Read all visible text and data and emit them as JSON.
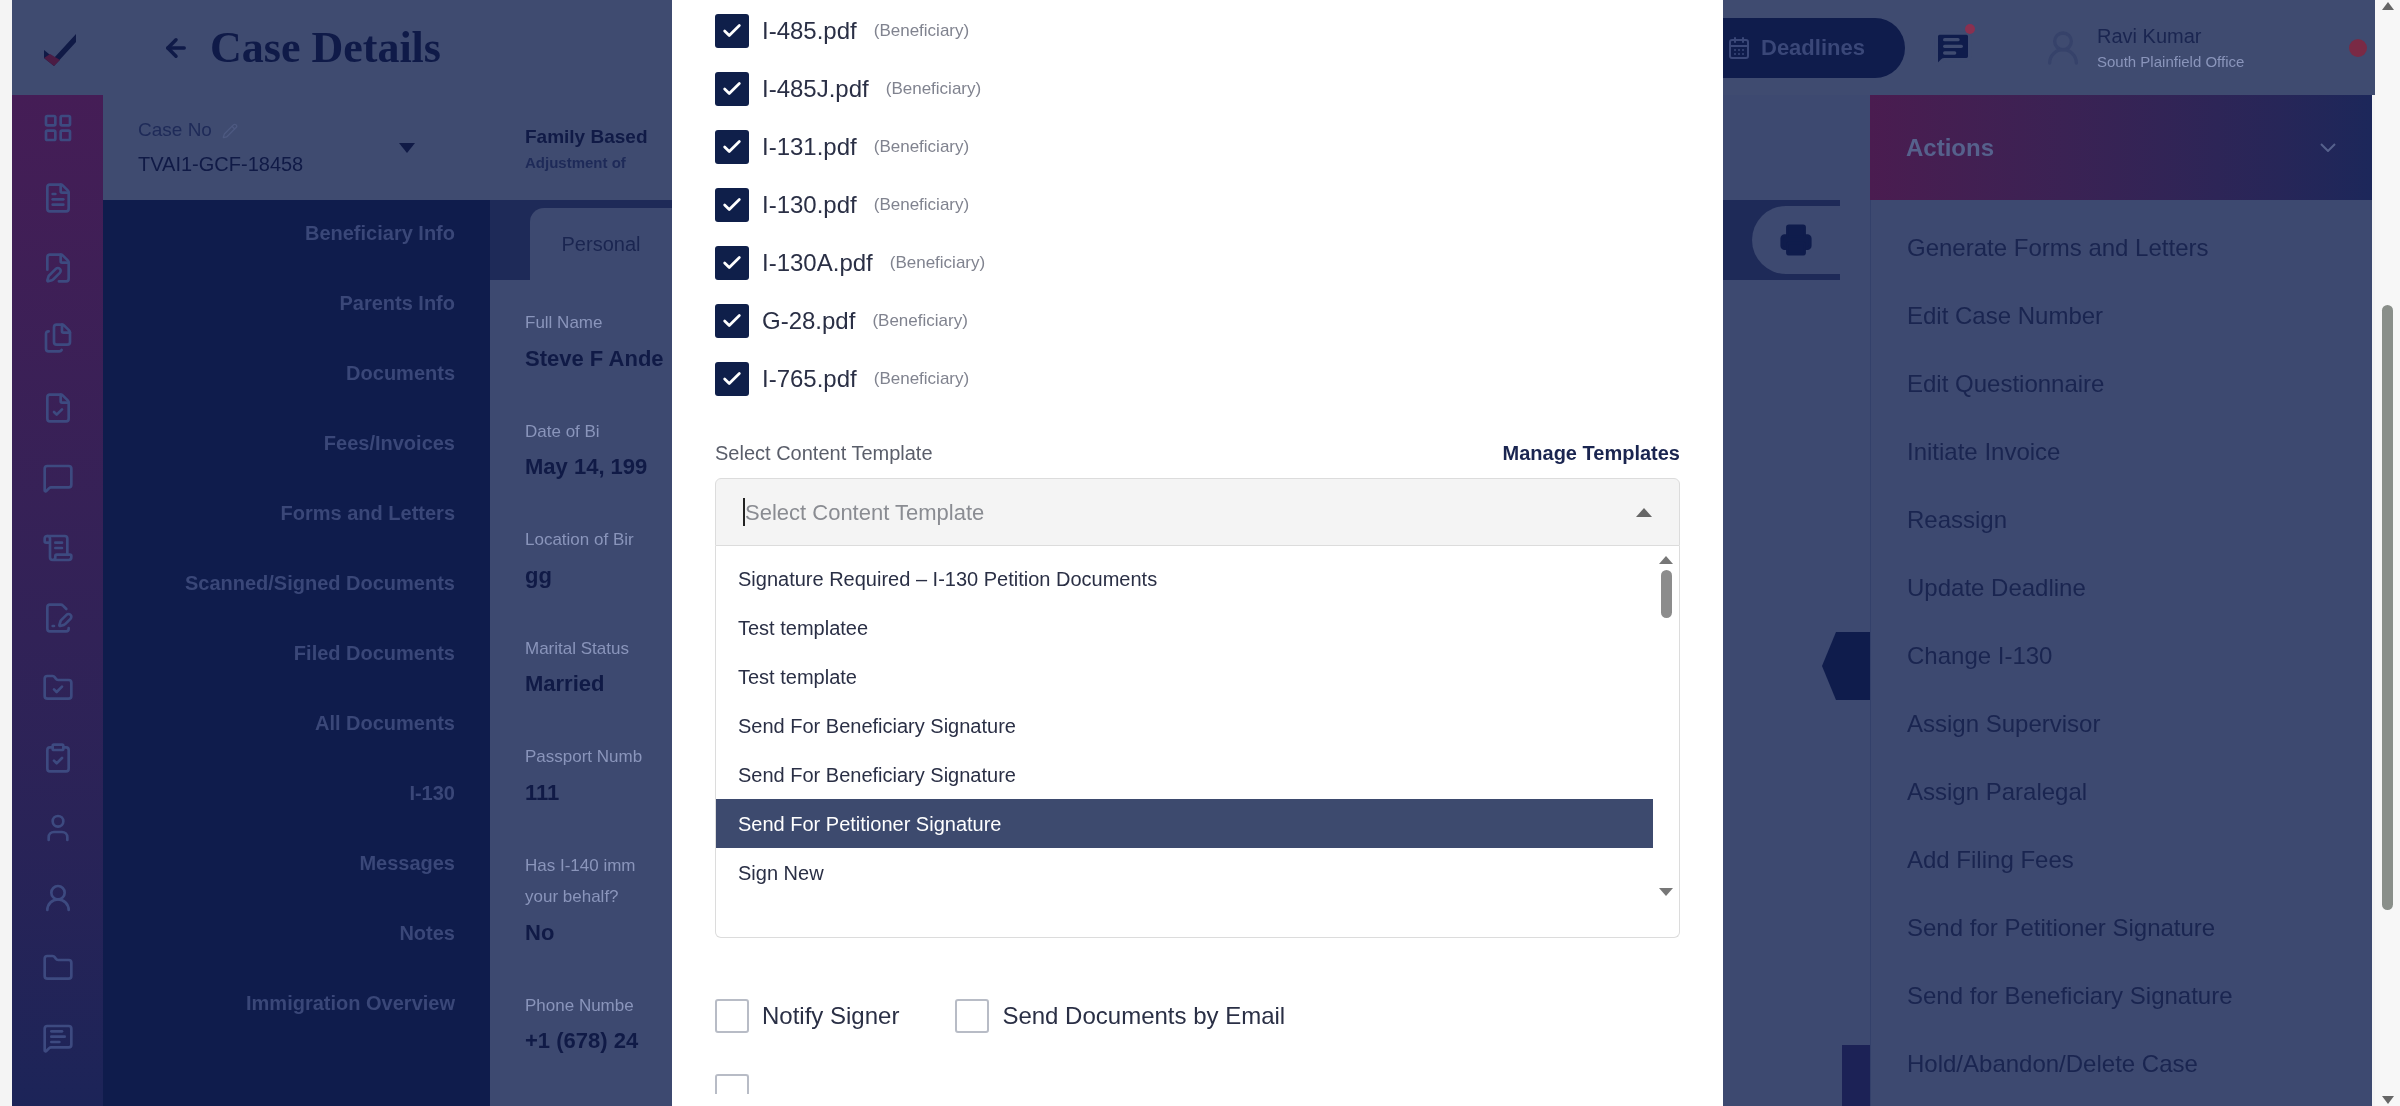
{
  "header": {
    "title": "Case Details"
  },
  "case": {
    "label": "Case No",
    "number": "TVAI1-GCF-18458",
    "type": "Family Based",
    "subtype": "Adjustment of"
  },
  "nav": {
    "items": [
      "Beneficiary Info",
      "Parents Info",
      "Documents",
      "Fees/Invoices",
      "Forms and Letters",
      "Scanned/Signed Documents",
      "Filed Documents",
      "All Documents",
      "I-130",
      "Messages",
      "Notes",
      "Immigration Overview"
    ]
  },
  "tabs": [
    {
      "label": "Personal",
      "selected": true
    }
  ],
  "fields": [
    {
      "label_lines": [
        "Full Name"
      ],
      "value": "Steve F Ande"
    },
    {
      "label_lines": [
        "Date of Bi"
      ],
      "value": "May 14, 199"
    },
    {
      "label_lines": [
        "Location of Bir"
      ],
      "value": "gg"
    },
    {
      "label_lines": [
        "Marital Status"
      ],
      "value": "Married"
    },
    {
      "label_lines": [
        "Passport Numb"
      ],
      "value": "111"
    },
    {
      "label_lines": [
        "Has I-140 imm",
        "your behalf?"
      ],
      "value": "No"
    },
    {
      "label_lines": [
        "Phone Numbe"
      ],
      "value": "+1 (678) 24"
    }
  ],
  "topbar": {
    "deadlines": "Deadlines",
    "chat_unread": true,
    "user_name": "Ravi Kumar",
    "user_office": "South Plainfield Office"
  },
  "modal": {
    "documents": [
      {
        "name": "I-485.pdf",
        "role": "(Beneficiary)",
        "checked": true
      },
      {
        "name": "I-485J.pdf",
        "role": "(Beneficiary)",
        "checked": true
      },
      {
        "name": "I-131.pdf",
        "role": "(Beneficiary)",
        "checked": true
      },
      {
        "name": "I-130.pdf",
        "role": "(Beneficiary)",
        "checked": true
      },
      {
        "name": "I-130A.pdf",
        "role": "(Beneficiary)",
        "checked": true
      },
      {
        "name": "G-28.pdf",
        "role": "(Beneficiary)",
        "checked": true
      },
      {
        "name": "I-765.pdf",
        "role": "(Beneficiary)",
        "checked": true
      }
    ],
    "template_label": "Select Content Template",
    "manage_link": "Manage Templates",
    "template_select": {
      "placeholder": "Select Content Template",
      "expanded": true
    },
    "template_options": [
      {
        "label": "Signature Required – I-130 Petition Documents",
        "selected": false
      },
      {
        "label": "Test templatee",
        "selected": false
      },
      {
        "label": "Test template",
        "selected": false
      },
      {
        "label": "Send For Beneficiary Signature",
        "selected": false
      },
      {
        "label": "Send For Beneficiary Signature",
        "selected": false
      },
      {
        "label": "Send For Petitioner Signature",
        "selected": true
      },
      {
        "label": "Sign New",
        "selected": false
      }
    ],
    "options": [
      {
        "label": "Notify Signer",
        "checked": false
      },
      {
        "label": "Send Documents by Email",
        "checked": false
      }
    ],
    "bottom_checkbox": {
      "checked": false
    }
  },
  "actions": {
    "title": "Actions",
    "expanded": true,
    "items": [
      "Generate Forms and Letters",
      "Edit Case Number",
      "Edit Questionnaire",
      "Initiate Invoice",
      "Reassign",
      "Update Deadline",
      "Change I-130",
      "Assign Supervisor",
      "Assign Paralegal",
      "Add Filing Fees",
      "Send for Petitioner Signature",
      "Send for Beneficiary Signature",
      "Hold/Abandon/Delete Case"
    ]
  }
}
